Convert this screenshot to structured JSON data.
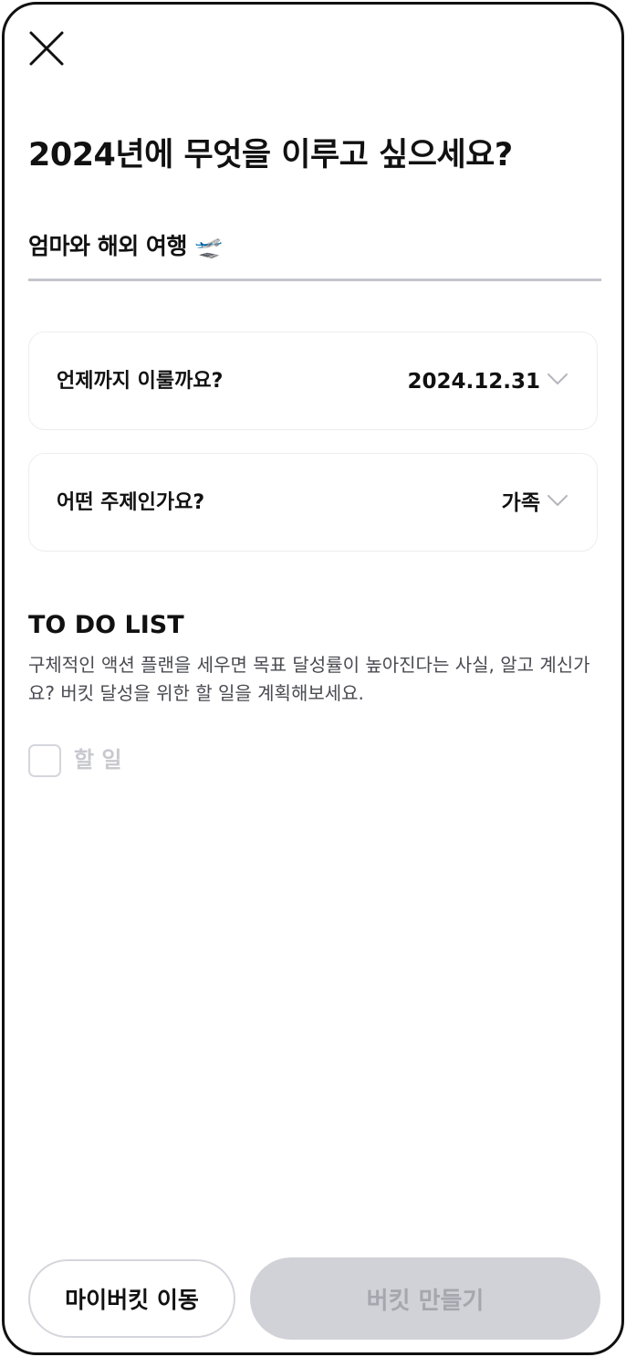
{
  "header": {
    "close_icon": "close-icon",
    "title": "2024년에 무엇을 이루고 싶으세요?"
  },
  "goal": {
    "value": "엄마와 해외 여행 🛫"
  },
  "deadline": {
    "label": "언제까지 이룰까요?",
    "value": "2024.12.31",
    "icon": "chevron-down-icon"
  },
  "category": {
    "label": "어떤 주제인가요?",
    "value": "가족",
    "icon": "chevron-down-icon"
  },
  "todo": {
    "section_title": "TO DO LIST",
    "description": "구체적인 액션 플랜을 세우면 목표 달성률이 높아진다는 사실, 알고 계신가요? 버킷 달성을 위한 할 일을 계획해보세요.",
    "item_placeholder": "할 일",
    "item_checked": false
  },
  "footer": {
    "my_bucket_label": "마이버킷 이동",
    "create_label": "버킷 만들기"
  },
  "colors": {
    "border": "#111111",
    "underline": "#c4c5cc",
    "card_border": "#ededf0",
    "disabled_button_bg": "#d1d2d8",
    "disabled_button_text": "#a6a7ae",
    "placeholder": "#c8c9cf"
  }
}
